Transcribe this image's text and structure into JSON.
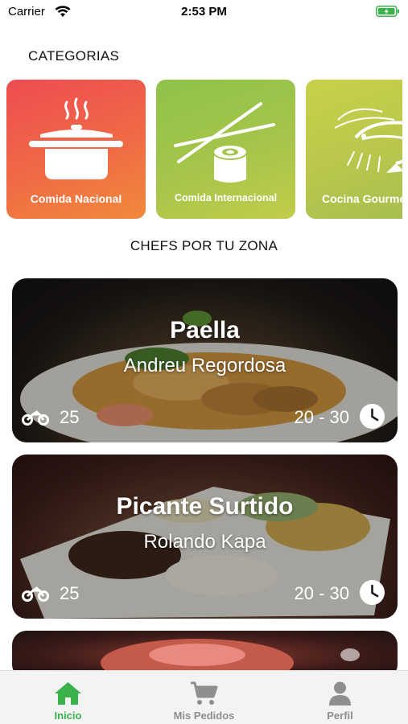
{
  "status_bar": {
    "carrier": "Carrier",
    "time": "2:53 PM",
    "battery_color": "#3ab14a"
  },
  "categories": {
    "title": "CATEGORIAS",
    "items": [
      {
        "label": "Comida Nacional",
        "icon": "cooking-pot-icon",
        "color": "#ee5a4a"
      },
      {
        "label": "Comida Internacional",
        "icon": "chopsticks-sushi-icon",
        "color": "#a2c44a"
      },
      {
        "label": "Cocina Gourmet",
        "icon": "shrimp-icon",
        "color": "#bcc84c"
      }
    ]
  },
  "chefs": {
    "title": "CHEFS POR TU ZONA",
    "items": [
      {
        "dish": "Paella",
        "chef": "Andreu Regordosa",
        "deliveries": "25",
        "time": "20 - 30"
      },
      {
        "dish": "Picante Surtido",
        "chef": "Rolando Kapa",
        "deliveries": "25",
        "time": "20 - 30"
      }
    ]
  },
  "tab_bar": {
    "accent_color": "#3ab14a",
    "inactive_color": "#8e8e8e",
    "tabs": [
      {
        "label": "Inicio",
        "icon": "home-icon",
        "active": true
      },
      {
        "label": "Mis Pedidos",
        "icon": "cart-icon",
        "active": false
      },
      {
        "label": "Perfil",
        "icon": "user-icon",
        "active": false
      }
    ]
  }
}
